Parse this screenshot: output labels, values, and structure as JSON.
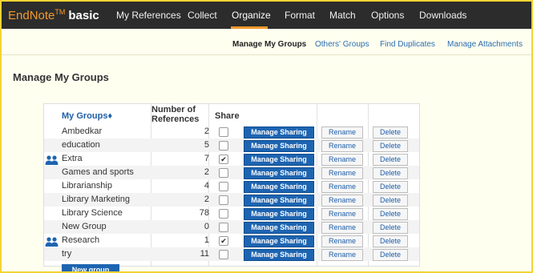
{
  "app": {
    "brand": "EndNote",
    "tm": "TM",
    "edition": "basic"
  },
  "nav": [
    "My References",
    "Collect",
    "Organize",
    "Format",
    "Match",
    "Options",
    "Downloads"
  ],
  "subnav": [
    "Manage My Groups",
    "Others' Groups",
    "Find Duplicates",
    "Manage Attachments"
  ],
  "page_title": "Manage My Groups",
  "table": {
    "headers": {
      "groups": "My Groups",
      "sort_icon": "♦",
      "refs_line1": "Number of",
      "refs_line2": "References",
      "share": "Share"
    },
    "buttons": {
      "manage_sharing": "Manage Sharing",
      "rename": "Rename",
      "delete": "Delete"
    },
    "rows": [
      {
        "name": "Ambedkar",
        "count": "2",
        "shared": false
      },
      {
        "name": "education",
        "count": "5",
        "shared": false
      },
      {
        "name": "Extra",
        "count": "7",
        "shared": true
      },
      {
        "name": "Games and sports",
        "count": "2",
        "shared": false
      },
      {
        "name": "Librarianship",
        "count": "4",
        "shared": false
      },
      {
        "name": "Library Marketing",
        "count": "2",
        "shared": false
      },
      {
        "name": "Library Science",
        "count": "78",
        "shared": false
      },
      {
        "name": "New Group",
        "count": "0",
        "shared": false
      },
      {
        "name": "Research",
        "count": "1",
        "shared": true
      },
      {
        "name": "try",
        "count": "11",
        "shared": false
      }
    ],
    "new_group": "New group"
  },
  "colors": {
    "accent": "#f39a2b",
    "topbar": "#2c2c2c",
    "button_blue": "#1d64b1",
    "frame_border": "#f3d433"
  }
}
